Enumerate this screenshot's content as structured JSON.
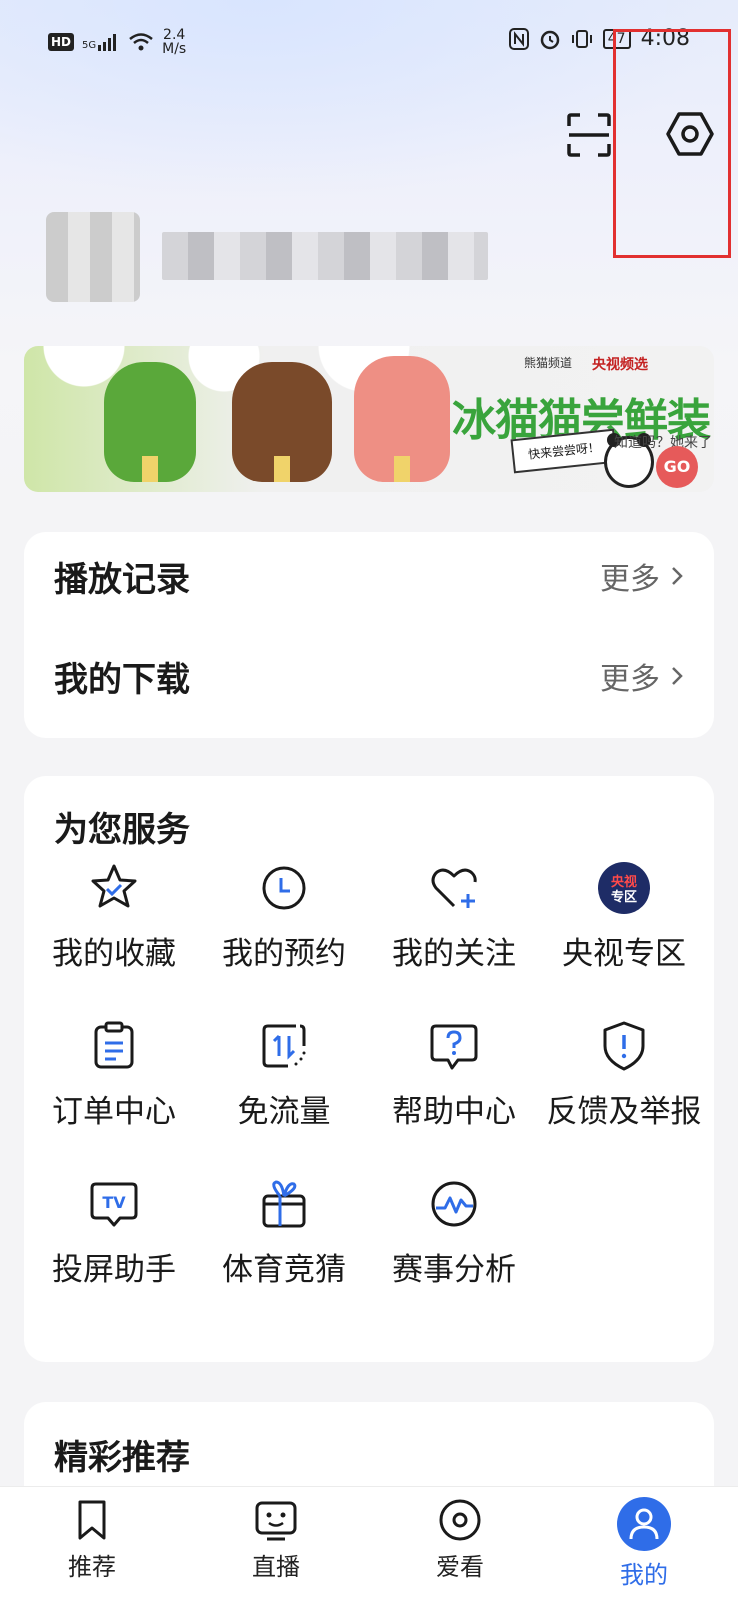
{
  "status_bar": {
    "hd": "HD",
    "network": "5G",
    "speed_value": "2.4",
    "speed_unit": "M/s",
    "battery": "47",
    "time": "4:08"
  },
  "colors": {
    "accent": "#2f6de8",
    "highlight_box": "#e23030",
    "banner_green": "#39a43c"
  },
  "header": {
    "scan_icon": "scan-icon",
    "settings_icon": "settings-icon"
  },
  "banner": {
    "title": "冰猫猫尝鲜装",
    "brand": "央视频选",
    "brand_prefix": "熊猫频道",
    "subtitle": "知道吗？她来了",
    "cta": "快来尝尝呀！",
    "go": "GO"
  },
  "history": {
    "play_record": "播放记录",
    "my_downloads": "我的下载",
    "more": "更多"
  },
  "services": {
    "title": "为您服务",
    "items": [
      {
        "label": "我的收藏",
        "icon": "star-icon"
      },
      {
        "label": "我的预约",
        "icon": "clock-icon"
      },
      {
        "label": "我的关注",
        "icon": "heart-plus-icon"
      },
      {
        "label": "央视专区",
        "icon": "cctv-badge-icon",
        "badge_top": "央视",
        "badge_bottom": "专区"
      },
      {
        "label": "订单中心",
        "icon": "clipboard-icon"
      },
      {
        "label": "免流量",
        "icon": "data-arrows-icon"
      },
      {
        "label": "帮助中心",
        "icon": "help-bubble-icon"
      },
      {
        "label": "反馈及举报",
        "icon": "shield-alert-icon"
      },
      {
        "label": "投屏助手",
        "icon": "tv-cast-icon",
        "badge": "TV"
      },
      {
        "label": "体育竞猜",
        "icon": "gift-icon"
      },
      {
        "label": "赛事分析",
        "icon": "pulse-icon"
      }
    ]
  },
  "recommend": {
    "title": "精彩推荐"
  },
  "tabbar": {
    "items": [
      {
        "label": "推荐",
        "icon": "bookmark-icon"
      },
      {
        "label": "直播",
        "icon": "tv-face-icon"
      },
      {
        "label": "爱看",
        "icon": "disc-icon"
      },
      {
        "label": "我的",
        "icon": "profile-icon",
        "active": true
      }
    ]
  }
}
